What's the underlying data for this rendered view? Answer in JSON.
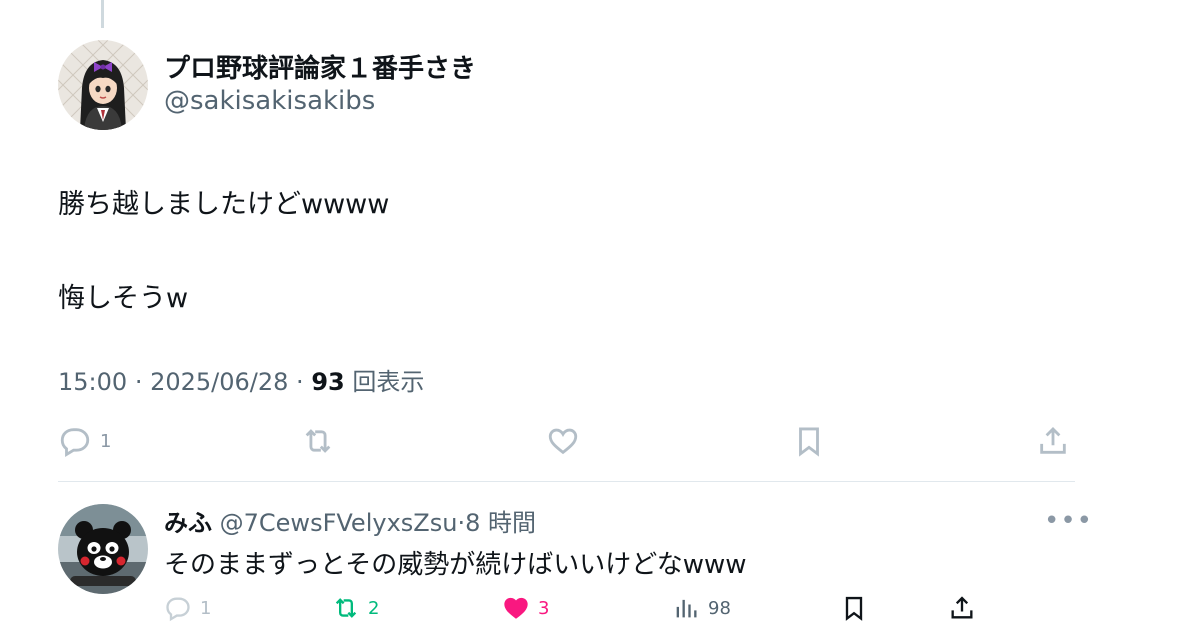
{
  "tweet": {
    "display_name": "プロ野球評論家１番手さき",
    "handle": "@sakisakisakibs",
    "text_line1": "勝ち越しましたけどwwww",
    "text_line2": "悔しそうw",
    "time": "15:00",
    "date": "2025/06/28",
    "views": "93",
    "views_label": "回表示",
    "reply_count": "1"
  },
  "reply": {
    "name": "みふ",
    "handle": "@7CewsFVelyxsZsu",
    "age": "8 時間",
    "text": "そのままずっとその威勢が続けばいいけどなwww",
    "reply_count": "1",
    "retweet_count": "2",
    "like_count": "3",
    "view_count": "98"
  },
  "colors": {
    "retweet_active": "#00ba7c",
    "like_active": "#f91880",
    "secondary_text": "#536471"
  },
  "icons": [
    "reply-icon",
    "retweet-icon",
    "like-icon",
    "bookmark-icon",
    "share-icon",
    "views-icon",
    "more-icon"
  ]
}
